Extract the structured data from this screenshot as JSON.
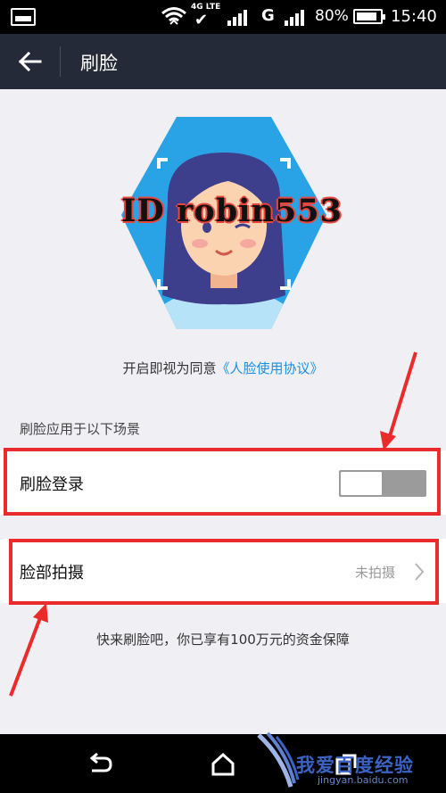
{
  "status_bar": {
    "network_label": "4G LTE",
    "network_g": "G",
    "battery": "80%",
    "time": "15:40"
  },
  "app_bar": {
    "title": "刷脸"
  },
  "face_image": {
    "watermark": "ID robin553"
  },
  "agreement": {
    "prefix": "开启即视为同意",
    "link": "《人脸使用协议》"
  },
  "section": {
    "title": "刷脸应用于以下场景"
  },
  "rows": {
    "login": {
      "label": "刷脸登录",
      "toggle_on": false
    },
    "face_photo": {
      "label": "脸部拍摄",
      "value": "未拍摄"
    }
  },
  "footer": {
    "note": "快来刷脸吧，你已享有100万元的资金保障"
  },
  "watermark_logo": {
    "text": "我爱百度经验",
    "url": "jingyan.baidu.com"
  },
  "colors": {
    "app_bar": "#242a37",
    "accent": "#1b8fe0",
    "highlight": "#ea2b2b",
    "hexagon": "#2aa3e6"
  }
}
